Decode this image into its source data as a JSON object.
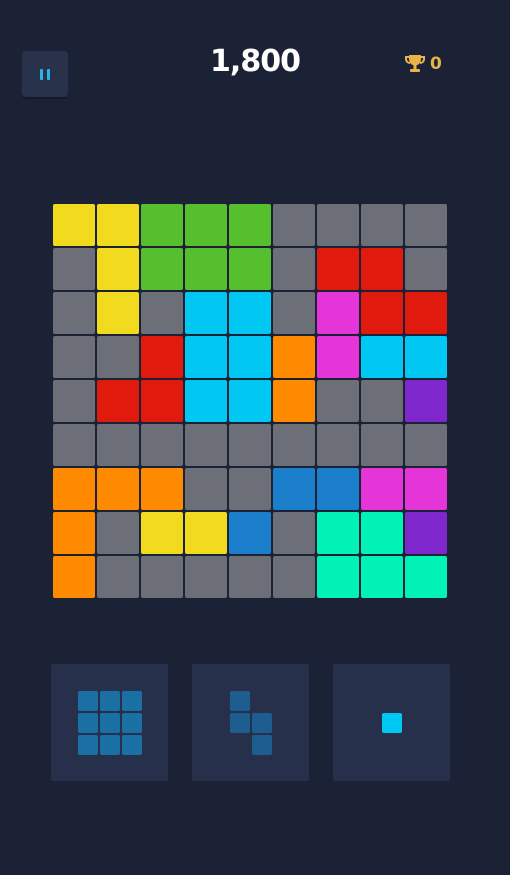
{
  "score": "1,800",
  "best": "0",
  "icons": {
    "pause": "pause-icon",
    "trophy": "trophy-icon"
  },
  "colors": {
    "background": "#1b2236",
    "empty": "#6c6e78",
    "yellow": "#f2db1f",
    "green": "#55bf2e",
    "red": "#e01b0e",
    "magenta": "#e534d8",
    "cyan": "#00c8f3",
    "orange": "#ff8a00",
    "purple": "#7e27cc",
    "blue": "#1b7fcc",
    "teal": "#00f2b6",
    "tray": "#26304a",
    "piece_dark": "#1e5d8f",
    "piece_mid": "#1a6fa3",
    "piece_cyan": "#00c8f3",
    "accent": "#2bb3e8",
    "gold": "#e9b347"
  },
  "board": [
    [
      "yellow",
      "yellow",
      "green",
      "green",
      "green",
      "empty",
      "empty",
      "empty",
      "empty"
    ],
    [
      "empty",
      "yellow",
      "green",
      "green",
      "green",
      "empty",
      "red",
      "red",
      "empty"
    ],
    [
      "empty",
      "yellow",
      "empty",
      "cyan",
      "cyan",
      "empty",
      "magenta",
      "red",
      "red"
    ],
    [
      "empty",
      "empty",
      "red",
      "cyan",
      "cyan",
      "orange",
      "magenta",
      "cyan",
      "cyan"
    ],
    [
      "empty",
      "red",
      "red",
      "cyan",
      "cyan",
      "orange",
      "empty",
      "empty",
      "purple"
    ],
    [
      "empty",
      "empty",
      "empty",
      "empty",
      "empty",
      "empty",
      "empty",
      "empty",
      "empty"
    ],
    [
      "orange",
      "orange",
      "orange",
      "empty",
      "empty",
      "blue",
      "blue",
      "magenta",
      "magenta"
    ],
    [
      "orange",
      "empty",
      "yellow",
      "yellow",
      "blue",
      "empty",
      "teal",
      "teal",
      "purple"
    ],
    [
      "orange",
      "empty",
      "empty",
      "empty",
      "empty",
      "empty",
      "teal",
      "teal",
      "teal"
    ]
  ],
  "pieces": [
    {
      "name": "square-3x3",
      "color": "piece_mid",
      "cells": [
        [
          0,
          0
        ],
        [
          0,
          1
        ],
        [
          0,
          2
        ],
        [
          1,
          0
        ],
        [
          1,
          1
        ],
        [
          1,
          2
        ],
        [
          2,
          0
        ],
        [
          2,
          1
        ],
        [
          2,
          2
        ]
      ]
    },
    {
      "name": "s-shape",
      "color": "piece_dark",
      "cells": [
        [
          0,
          0
        ],
        [
          1,
          0
        ],
        [
          1,
          1
        ],
        [
          2,
          1
        ]
      ]
    },
    {
      "name": "single",
      "color": "piece_cyan",
      "cells": [
        [
          0,
          0
        ]
      ]
    }
  ]
}
